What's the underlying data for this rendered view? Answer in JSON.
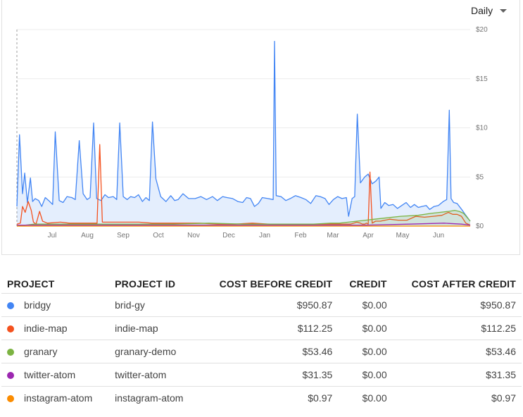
{
  "period_selector": {
    "label": "Daily"
  },
  "chart_data": {
    "type": "area",
    "title": "",
    "xlabel": "",
    "ylabel": "",
    "x_tick_labels": [
      "Jul",
      "Aug",
      "Sep",
      "Oct",
      "Nov",
      "Dec",
      "Jan",
      "Feb",
      "Mar",
      "Apr",
      "May",
      "Jun"
    ],
    "y_tick_labels": [
      "$20",
      "$15",
      "$10",
      "$5",
      "$0"
    ],
    "y_ticks": [
      20,
      15,
      10,
      5,
      0
    ],
    "ylim": [
      0,
      20
    ],
    "grid": true,
    "legend": "table below chart",
    "series": [
      {
        "name": "bridgy",
        "color": "#4285f4",
        "values": [
          2.0,
          9.3,
          3.3,
          5.4,
          2.4,
          4.9,
          2.5,
          2.8,
          2.6,
          2.0,
          2.9,
          2.6,
          2.2,
          9.6,
          2.6,
          2.4,
          3.0,
          2.9,
          2.7,
          8.7,
          3.3,
          2.7,
          2.9,
          10.5,
          2.8,
          2.6,
          3.2,
          2.9,
          3.0,
          2.7,
          10.5,
          3.0,
          2.7,
          3.0,
          2.9,
          3.2,
          2.5,
          2.9,
          2.6,
          10.6,
          4.8,
          3.0,
          2.5,
          3.1,
          2.6,
          2.7,
          3.3,
          2.8,
          2.8,
          3.0,
          2.7,
          3.0,
          2.6,
          3.0,
          2.9,
          2.8,
          2.5,
          2.4,
          2.9,
          2.8,
          2.0,
          2.3,
          2.9,
          2.8,
          2.7,
          18.8,
          3.1,
          3.0,
          2.6,
          2.8,
          3.1,
          2.9,
          2.7,
          2.3,
          3.1,
          3.0,
          2.8,
          2.2,
          2.7,
          3.0,
          2.8,
          2.9,
          1.0,
          2.8,
          3.0,
          11.4,
          4.4,
          5.0,
          5.3,
          4.3,
          4.6,
          5.0,
          1.8,
          2.4,
          2.1,
          2.2,
          1.8,
          2.1,
          2.4,
          1.9,
          2.2,
          1.9,
          2.0,
          2.1,
          1.7,
          2.0,
          2.1,
          2.5,
          2.7,
          11.8,
          2.8,
          2.4,
          2.3,
          1.6,
          1.1,
          0.5
        ],
        "x_positions": [
          0,
          0.6,
          1.3,
          1.8,
          2.4,
          3.1,
          3.6,
          4.2,
          5.0,
          5.7,
          6.5,
          7.3,
          8.2,
          8.8,
          9.7,
          10.6,
          11.5,
          12.6,
          13.4,
          14.3,
          15.2,
          16.1,
          16.8,
          17.6,
          18.3,
          19.3,
          20.2,
          21.0,
          22.1,
          22.9,
          23.6,
          24.4,
          25.3,
          26.1,
          27.0,
          27.9,
          28.8,
          29.6,
          30.4,
          31.1,
          31.9,
          33.0,
          34.2,
          35.3,
          36.2,
          37.0,
          38.1,
          39.4,
          40.9,
          42.2,
          43.5,
          44.9,
          46.0,
          47.2,
          48.2,
          49.5,
          50.7,
          51.8,
          52.7,
          53.6,
          54.5,
          55.4,
          56.3,
          57.6,
          58.8,
          59.1,
          59.5,
          60.6,
          61.7,
          62.7,
          63.9,
          65.2,
          66.3,
          67.4,
          68.6,
          69.6,
          70.7,
          71.6,
          72.6,
          73.6,
          74.6,
          75.6,
          76.1,
          76.9,
          77.5,
          78.1,
          78.8,
          79.8,
          80.6,
          81.5,
          82.4,
          83.1,
          83.5,
          84.4,
          85.3,
          86.3,
          87.3,
          88.3,
          89.3,
          90.3,
          91.2,
          92.1,
          92.9,
          93.9,
          94.7,
          95.7,
          96.7,
          97.8,
          98.6,
          99.2,
          99.6,
          100.2,
          101.0,
          102.2,
          103.0,
          104.0
        ]
      },
      {
        "name": "indie-map",
        "color": "#f4511e",
        "values": [
          0.2,
          0.3,
          2.0,
          1.4,
          2.5,
          1.6,
          0.4,
          0.2,
          1.5,
          0.5,
          0.3,
          0.4,
          0.3,
          0.3,
          0.3,
          0.3,
          0.3,
          0.3,
          0.3,
          8.3,
          0.4,
          0.4,
          0.4,
          0.4,
          0.3,
          0.3,
          0.3,
          0.3,
          0.2,
          0.2,
          0.3,
          0.2,
          0.2,
          0.2,
          0.2,
          0.2,
          0.2,
          0.2,
          0.2,
          0.2,
          0.2,
          0.2,
          0.2,
          0.3,
          0.4,
          0.3,
          0.2,
          0.2,
          0.3,
          0.2,
          5.5,
          0.3,
          0.5,
          0.5,
          0.7,
          0.6,
          0.6,
          1.0,
          0.9,
          1.0,
          1.1,
          1.4,
          1.2,
          1.2,
          1.0,
          0.3,
          0.1
        ],
        "x_positions": [
          0,
          0.8,
          1.3,
          1.9,
          2.6,
          3.3,
          3.8,
          4.4,
          5.2,
          5.9,
          7.0,
          10.0,
          12.0,
          14.0,
          15.8,
          16.6,
          17.3,
          18.0,
          18.4,
          19.0,
          19.6,
          22.0,
          25.0,
          28.0,
          31.0,
          34.0,
          38.0,
          42.0,
          46.0,
          50.0,
          54.0,
          58.0,
          60.0,
          62.0,
          64.0,
          66.0,
          68.0,
          70.0,
          72.0,
          74.0,
          75.0,
          76.0,
          76.5,
          77.3,
          78.0,
          78.8,
          79.3,
          79.8,
          80.2,
          80.6,
          81.0,
          81.5,
          82.3,
          83.4,
          85.5,
          87.5,
          89.5,
          91.5,
          93.5,
          95.5,
          97.5,
          99.0,
          100.0,
          101.0,
          102.0,
          103.0,
          104.0
        ]
      },
      {
        "name": "granary",
        "color": "#7cb342",
        "values": [
          0.0,
          0.2,
          0.2,
          0.2,
          0.2,
          0.2,
          0.3,
          0.2,
          0.2,
          0.2,
          0.3,
          0.3,
          0.4,
          0.5,
          0.6,
          0.7,
          0.8,
          1.0,
          1.1,
          1.3,
          1.4,
          1.5,
          1.6,
          1.5,
          1.3,
          0.5
        ],
        "x_positions": [
          0,
          4,
          12,
          20,
          28,
          36,
          44,
          52,
          60,
          68,
          72,
          74,
          76,
          78,
          80,
          82,
          84,
          88,
          92,
          95,
          97,
          99,
          100.5,
          101.5,
          102.5,
          104
        ]
      },
      {
        "name": "twitter-atom",
        "color": "#9c27b0",
        "values": [
          0.1,
          0.1,
          0.1,
          0.1,
          0.2,
          0.3,
          0.2,
          0.1
        ],
        "x_positions": [
          0,
          30,
          60,
          80,
          90,
          98,
          102,
          104
        ]
      },
      {
        "name": "instagram-atom",
        "color": "#fb8c00",
        "values": [
          0.0,
          0.0,
          0.0,
          0.0
        ],
        "x_positions": [
          0,
          40,
          80,
          104
        ]
      }
    ]
  },
  "table": {
    "headers": {
      "project": "PROJECT",
      "project_id": "PROJECT ID",
      "cost_before": "COST BEFORE CREDIT",
      "credit": "CREDIT",
      "cost_after": "COST AFTER CREDIT"
    },
    "rows": [
      {
        "color": "#4285f4",
        "project": "bridgy",
        "project_id": "brid-gy",
        "cost_before": "$950.87",
        "credit": "$0.00",
        "cost_after": "$950.87"
      },
      {
        "color": "#f4511e",
        "project": "indie-map",
        "project_id": "indie-map",
        "cost_before": "$112.25",
        "credit": "$0.00",
        "cost_after": "$112.25"
      },
      {
        "color": "#7cb342",
        "project": "granary",
        "project_id": "granary-demo",
        "cost_before": "$53.46",
        "credit": "$0.00",
        "cost_after": "$53.46"
      },
      {
        "color": "#9c27b0",
        "project": "twitter-atom",
        "project_id": "twitter-atom",
        "cost_before": "$31.35",
        "credit": "$0.00",
        "cost_after": "$31.35"
      },
      {
        "color": "#fb8c00",
        "project": "instagram-atom",
        "project_id": "instagram-atom",
        "cost_before": "$0.97",
        "credit": "$0.00",
        "cost_after": "$0.97"
      }
    ]
  }
}
